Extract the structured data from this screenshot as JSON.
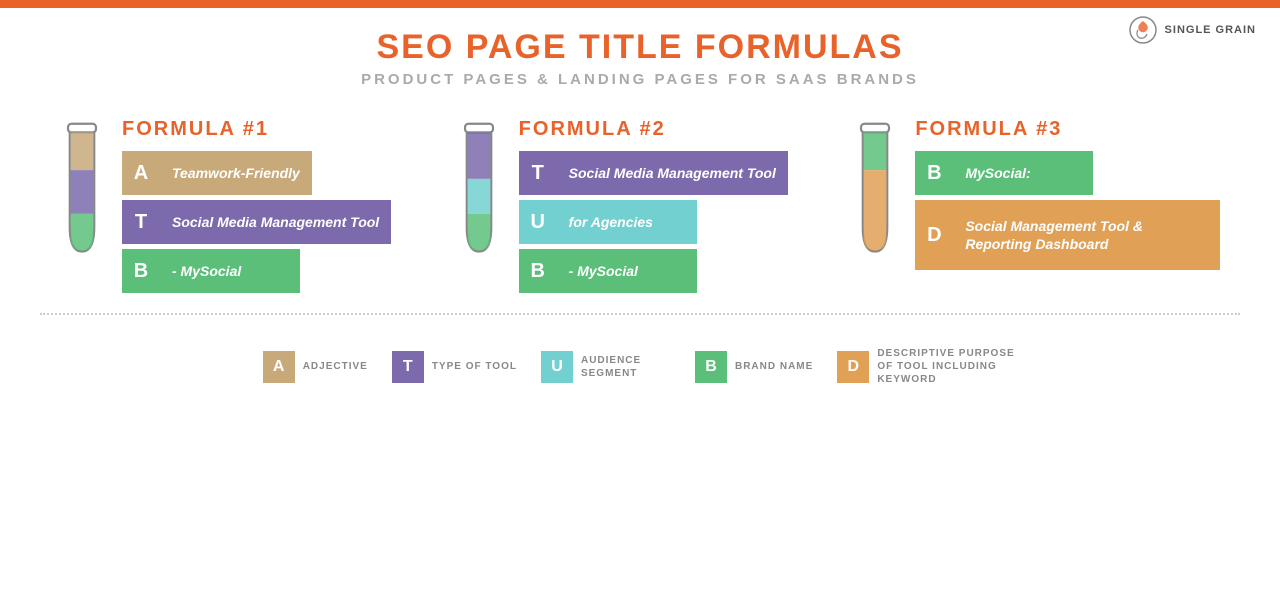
{
  "topbar": {},
  "logo": {
    "text": "SINGLE GRAIN"
  },
  "header": {
    "title_plain": "SEO PAGE TITLE ",
    "title_accent": "FORMULAS",
    "subtitle": "PRODUCT PAGES & LANDING PAGES FOR SAAS BRANDS"
  },
  "formulas": [
    {
      "id": "formula1",
      "label": "FORMULA #1",
      "rows": [
        {
          "letter": "A",
          "text": "Teamwork-Friendly",
          "letter_color": "tan",
          "text_color": "tan"
        },
        {
          "letter": "T",
          "text": "Social Media Management Tool",
          "letter_color": "purple",
          "text_color": "purple"
        },
        {
          "letter": "B",
          "text": "- MySocial",
          "letter_color": "green",
          "text_color": "green"
        }
      ]
    },
    {
      "id": "formula2",
      "label": "FORMULA #2",
      "rows": [
        {
          "letter": "T",
          "text": "Social Media Management Tool",
          "letter_color": "purple",
          "text_color": "purple"
        },
        {
          "letter": "U",
          "text": "for Agencies",
          "letter_color": "light_teal",
          "text_color": "light_teal"
        },
        {
          "letter": "B",
          "text": "- MySocial",
          "letter_color": "green",
          "text_color": "green"
        }
      ]
    },
    {
      "id": "formula3",
      "label": "FORMULA #3",
      "rows": [
        {
          "letter": "B",
          "text": "MySocial:",
          "letter_color": "green",
          "text_color": "green"
        },
        {
          "letter": "D",
          "text": "Social Management Tool & Reporting Dashboard",
          "letter_color": "orange",
          "text_color": "orange"
        }
      ]
    }
  ],
  "legend": [
    {
      "letter": "A",
      "color": "tan",
      "desc": "ADJECTIVE"
    },
    {
      "letter": "T",
      "color": "purple",
      "desc": "TYPE OF TOOL"
    },
    {
      "letter": "U",
      "color": "light_teal",
      "desc": "AUDIENCE SEGMENT"
    },
    {
      "letter": "B",
      "color": "green",
      "desc": "BRAND NAME"
    },
    {
      "letter": "D",
      "color": "orange",
      "desc": "DESCRIPTIVE PURPOSE OF TOOL INCLUDING KEYWORD"
    }
  ]
}
